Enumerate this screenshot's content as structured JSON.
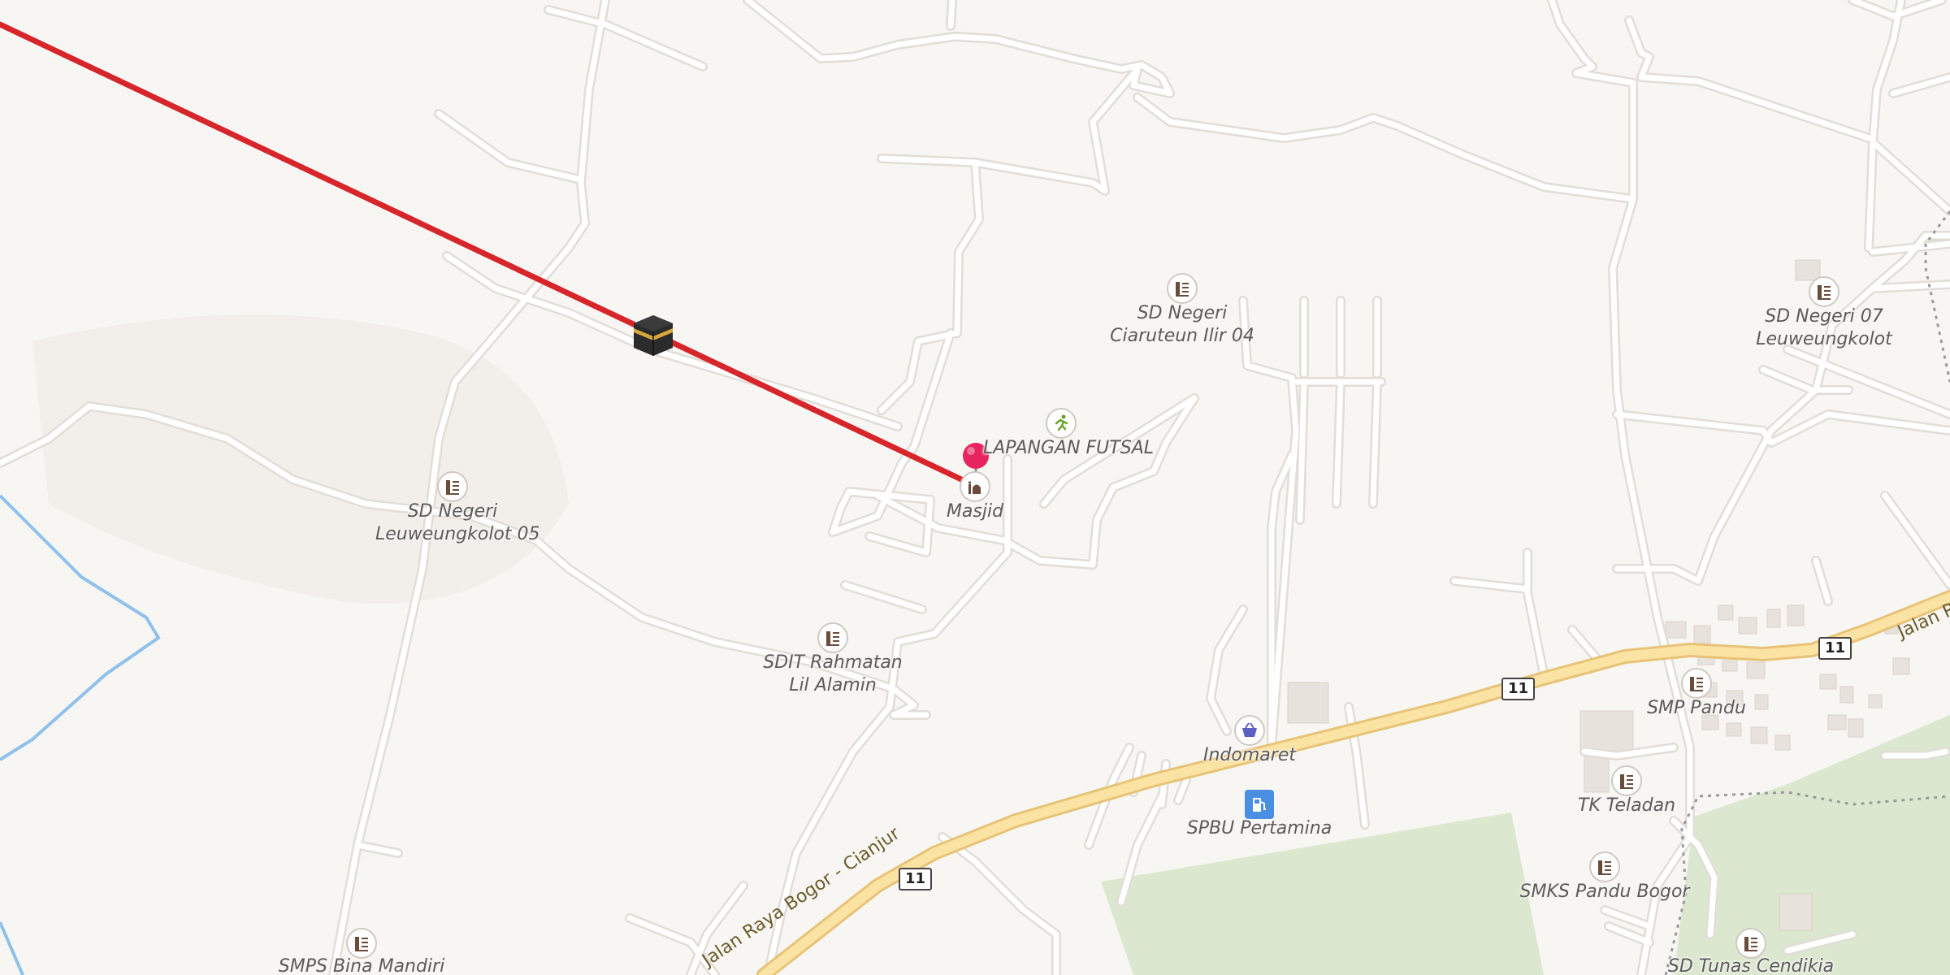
{
  "map": {
    "colors": {
      "background": "#f8f6f3",
      "road_minor": "#ffffff",
      "road_casing": "#e1ddd7",
      "road_primary": "#fbe3a4",
      "road_primary_casing": "#e8c377",
      "park": "#dbe8cf",
      "water": "#8fc1ea",
      "qibla_line": "#d6262b",
      "pin": "#e8245f",
      "label": "#5b5b5b"
    },
    "qibla_marker": {
      "icon": "kaaba-icon"
    },
    "location_pin": {
      "icon": "map-pin-icon"
    },
    "pois": [
      {
        "id": "masjid",
        "label": "Masjid",
        "icon": "mosque-icon"
      },
      {
        "id": "lapangan",
        "label": "LAPANGAN FUTSAL",
        "icon": "running-icon"
      },
      {
        "id": "sd04",
        "label": "SD Negeri Ciaruteun Ilir 04",
        "label_lines": [
          "SD Negeri",
          "Ciaruteun Ilir 04"
        ],
        "icon": "school-icon"
      },
      {
        "id": "sd05",
        "label": "SD Negeri Leuweungkolot 05",
        "label_lines": [
          "SD Negeri",
          "Leuweungkolot 05"
        ],
        "icon": "school-icon"
      },
      {
        "id": "sdit",
        "label": "SDIT Rahmatan Lil Alamin",
        "label_lines": [
          "SDIT Rahmatan",
          "Lil Alamin"
        ],
        "icon": "school-icon"
      },
      {
        "id": "sd07",
        "label": "SD Negeri 07 Leuweungkolot",
        "label_lines": [
          "SD Negeri 07",
          "Leuweungkolot"
        ],
        "icon": "school-icon"
      },
      {
        "id": "indomaret",
        "label": "Indomaret",
        "icon": "shopping-basket-icon"
      },
      {
        "id": "spbu",
        "label": "SPBU Pertamina",
        "icon": "fuel-pump-icon"
      },
      {
        "id": "smp",
        "label": "SMP Pandu",
        "icon": "school-icon"
      },
      {
        "id": "tk",
        "label": "TK Teladan",
        "icon": "school-icon"
      },
      {
        "id": "smks",
        "label": "SMKS Pandu Bogor",
        "icon": "school-icon"
      },
      {
        "id": "smps",
        "label": "SMPS Bina Mandiri",
        "icon": "school-icon"
      },
      {
        "id": "sdtunas",
        "label": "SD Tunas Cendikia",
        "icon": "school-icon"
      }
    ],
    "road_shields": [
      "11",
      "11",
      "11"
    ],
    "road_names": [
      "Jalan Raya Bogor - Cianjur",
      "Jalan R"
    ]
  }
}
